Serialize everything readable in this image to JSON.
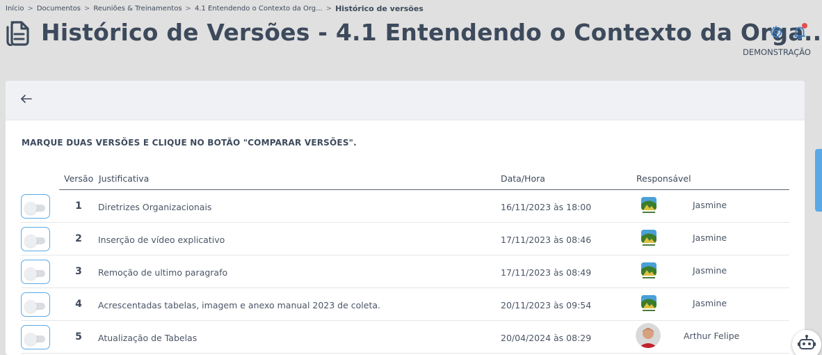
{
  "breadcrumb": {
    "items": [
      "Início",
      "Documentos",
      "Reuniões & Treinamentos",
      "4.1 Entendendo o Contexto da Org..."
    ],
    "current": "Histórico de versões",
    "separator": ">"
  },
  "header": {
    "title": "Histórico de Versões - 4.1 Entendendo o Contexto da Orga...",
    "user": "DEMONSTRAÇÃO"
  },
  "instruction": "MARQUE DUAS VERSÕES E CLIQUE NO BOTÃO \"COMPARAR VERSÕES\".",
  "table": {
    "headers": {
      "version": "Versão",
      "justification": "Justificativa",
      "datetime": "Data/Hora",
      "responsible": "Responsável"
    },
    "rows": [
      {
        "version": "1",
        "justification": "Diretrizes Organizacionais",
        "datetime": "16/11/2023 às 18:00",
        "responsible": "Jasmine",
        "avatar": "logo",
        "selected": false
      },
      {
        "version": "2",
        "justification": "Inserção de vídeo explicativo",
        "datetime": "17/11/2023 às 08:46",
        "responsible": "Jasmine",
        "avatar": "logo",
        "selected": false
      },
      {
        "version": "3",
        "justification": "Remoção de ultimo paragrafo",
        "datetime": "17/11/2023 às 08:49",
        "responsible": "Jasmine",
        "avatar": "logo",
        "selected": false
      },
      {
        "version": "4",
        "justification": "Acrescentadas tabelas, imagem e anexo manual 2023 de coleta.",
        "datetime": "20/11/2023 às 09:54",
        "responsible": "Jasmine",
        "avatar": "logo",
        "selected": false
      },
      {
        "version": "5",
        "justification": "Atualização de Tabelas",
        "datetime": "20/04/2024 às 08:29",
        "responsible": "Arthur Felipe",
        "avatar": "photo",
        "selected": false
      }
    ]
  },
  "icons": {
    "title": "document-icon",
    "settings": "gear-icon",
    "notifications": "bell-icon",
    "back": "arrow-left-icon",
    "assistant": "robot-icon"
  },
  "colors": {
    "text": "#3d4a5c",
    "accent": "#5aa9e6",
    "notification": "#e05050",
    "toggle_off": "#d9dce1"
  }
}
